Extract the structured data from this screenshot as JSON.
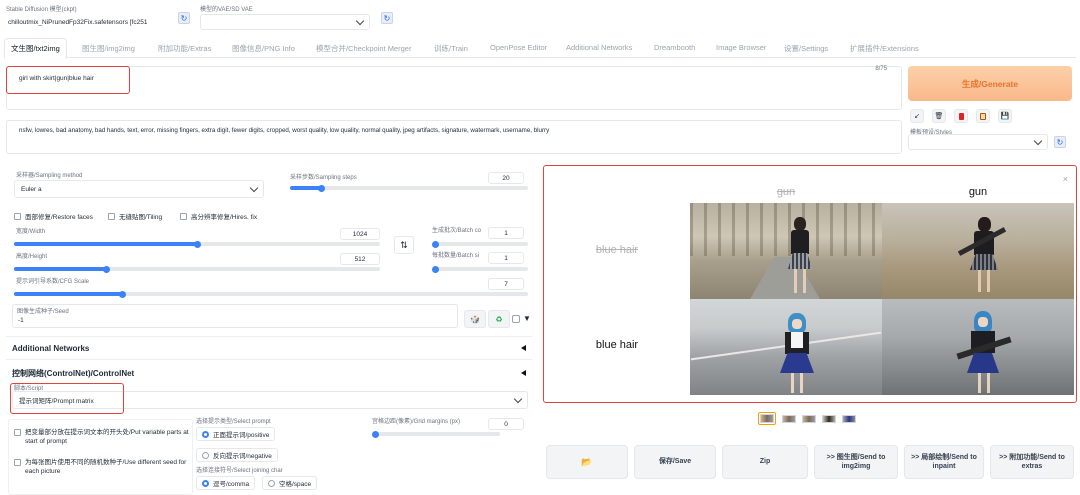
{
  "header": {
    "model_label": "Stable Diffusion 模型(ckpt)",
    "model_value": "chilloutmix_NiPrunedFp32Fix.safetensors [fc251",
    "vae_label": "模型的VAE/SD VAE",
    "vae_value": ""
  },
  "tabs": [
    "文生图/txt2img",
    "图生图/img2img",
    "附加功能/Extras",
    "图像信息/PNG Info",
    "模型合并/Checkpoint Merger",
    "训练/Train",
    "OpenPose Editor",
    "Additional Networks",
    "Dreambooth",
    "Image Browser",
    "设置/Settings",
    "扩展插件/Extensions"
  ],
  "prompt": {
    "value": "girl with skirt|gun|blue hair",
    "counter": "8/75"
  },
  "negative_prompt": {
    "value": "nsfw, lowres, bad anatomy, bad hands, text, error, missing fingers, extra digit, fewer digits, cropped, worst quality, low quality, normal quality, jpeg artifacts, signature, watermark, username, blurry"
  },
  "generate_label": "生成/Generate",
  "styles_label": "模板预设/Styles",
  "toolbar_icons": [
    "arrow-down-left-icon",
    "trash-icon",
    "red-card-icon",
    "clipboard-icon",
    "floppy-disk-icon"
  ],
  "sampling": {
    "method_label": "采样器/Sampling method",
    "method_value": "Euler a",
    "steps_label": "采样步数/Sampling steps",
    "steps_value": "20",
    "steps_fraction": 0.13
  },
  "checks": {
    "restore_faces": "面部修复/Restore faces",
    "tiling": "无缝贴图/Tiling",
    "hires_fix": "高分辨率修复/Hires. fix"
  },
  "width": {
    "label": "宽度/Width",
    "value": "1024",
    "fraction": 0.5
  },
  "height": {
    "label": "高度/Height",
    "value": "512",
    "fraction": 0.25
  },
  "swap_icon": "⇅",
  "batch_count": {
    "label": "生成批次/Batch co",
    "value": "1",
    "fraction": 0
  },
  "batch_size": {
    "label": "每批数量/Batch si",
    "value": "1",
    "fraction": 0
  },
  "cfg": {
    "label": "提示词引导系数/CFG Scale",
    "value": "7",
    "fraction": 0.21
  },
  "seed": {
    "label": "图像生成种子/Seed",
    "value": "-1"
  },
  "accordions": {
    "additional_networks": "Additional Networks",
    "controlnet": "控制网络(ControlNet)/ControlNet"
  },
  "script": {
    "label": "脚本/Script",
    "value": "提示词矩阵/Prompt matrix"
  },
  "prompt_matrix": {
    "put_variable": "把变量部分放在提示词文本的开头处/Put variable parts at start of prompt",
    "different_seed": "为每张图片使用不同的随机数种子/Use different seed for each picture",
    "select_prompt_label": "选择提示类型/Select prompt",
    "positive": "正面提示词/positive",
    "negative": "反向提示词/negative",
    "joining_label": "选择连接符号/Select joining char",
    "comma": "逗号/comma",
    "space": "空格/space",
    "grid_margins_label": "宫格边距(像素)/Grid margins (px)",
    "grid_margins_value": "0"
  },
  "output": {
    "col_headers": [
      "gun",
      "gun"
    ],
    "row_headers": [
      "blue hair",
      "blue hair"
    ],
    "close_glyph": "×"
  },
  "actions": {
    "folder": "📂",
    "save": "保存/Save",
    "zip": "Zip",
    "send_img2img": ">> 图生图/Send to img2img",
    "send_inpaint": ">> 局部绘制/Send to inpaint",
    "send_extras": ">> 附加功能/Send to extras"
  },
  "colors": {
    "accent": "#3b82f6",
    "generate_bg": "#fbc59a",
    "generate_text": "#e8742a",
    "annotation_red": "#e0443a"
  }
}
